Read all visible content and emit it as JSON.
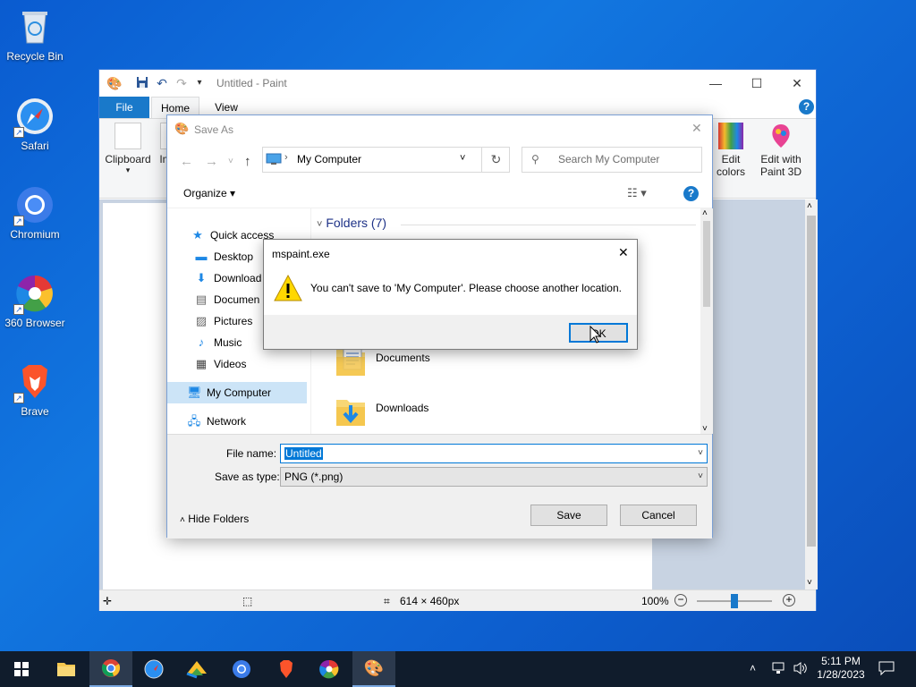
{
  "desktop": {
    "icons": [
      {
        "label": "Recycle Bin",
        "icon": "recycle-bin-icon"
      },
      {
        "label": "Safari",
        "icon": "safari-icon"
      },
      {
        "label": "Chromium",
        "icon": "chromium-icon"
      },
      {
        "label": "360 Browser",
        "icon": "360-browser-icon"
      },
      {
        "label": "Brave",
        "icon": "brave-icon"
      }
    ]
  },
  "paint": {
    "title": "Untitled - Paint",
    "tabs": {
      "file": "File",
      "home": "Home",
      "view": "View"
    },
    "ribbon": {
      "clipboard": "Clipboard",
      "image_partial": "Im",
      "edit_colors_line1": "Edit",
      "edit_colors_line2": "colors",
      "edit_3d_line1": "Edit with",
      "edit_3d_line2": "Paint 3D"
    },
    "status": {
      "size": "614 × 460px",
      "zoom": "100%"
    }
  },
  "save_as": {
    "title": "Save As",
    "address": "My Computer",
    "search_placeholder": "Search My Computer",
    "organize": "Organize",
    "nav": {
      "quick_access": "Quick access",
      "desktop": "Desktop",
      "downloads": "Download",
      "documents": "Documen",
      "pictures": "Pictures",
      "music": "Music",
      "videos": "Videos",
      "my_computer": "My Computer",
      "network": "Network"
    },
    "group_header": "Folders (7)",
    "folders": [
      "Documents",
      "Downloads"
    ],
    "file_name_label": "File name:",
    "file_name_value": "Untitled",
    "save_type_label": "Save as type:",
    "save_type_value": "PNG (*.png)",
    "hide_folders": "Hide Folders",
    "save_btn": "Save",
    "cancel_btn": "Cancel"
  },
  "error_dialog": {
    "title": "mspaint.exe",
    "message": "You can't save to 'My Computer'. Please choose another location.",
    "ok": "OK"
  },
  "taskbar": {
    "time": "5:11 PM",
    "date": "1/28/2023"
  },
  "colors": {
    "accent": "#0078d7",
    "file_tab": "#1979ca",
    "taskbar": "#101c2c"
  }
}
